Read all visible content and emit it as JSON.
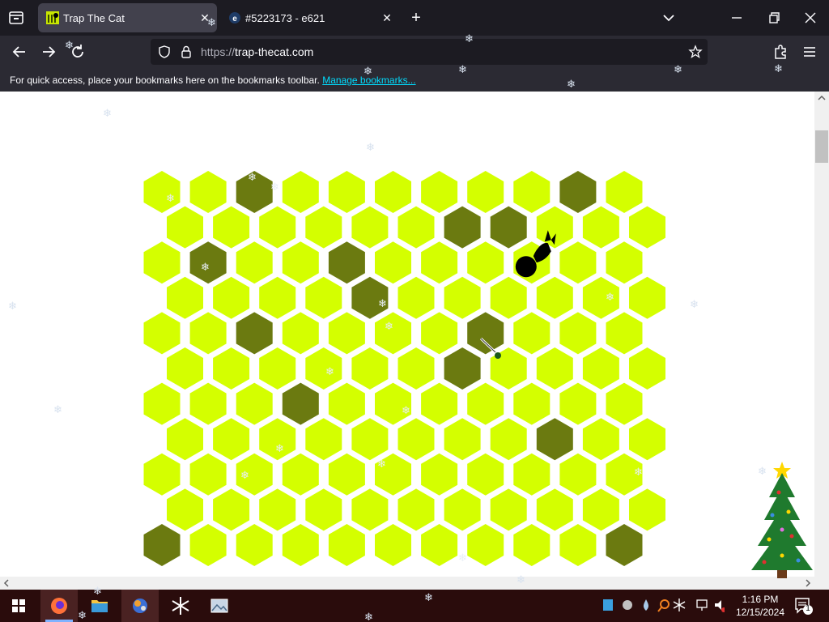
{
  "browser": {
    "tabs": [
      {
        "title": "Trap The Cat",
        "active": true,
        "favicon": "trap-cat-favicon"
      },
      {
        "title": "#5223173 - e621",
        "active": false,
        "favicon": "e621-favicon"
      }
    ],
    "new_tab_label": "+",
    "url": {
      "scheme": "https://",
      "host": "trap-thecat.com"
    },
    "bookmarks_message": "For quick access, place your bookmarks here on the bookmarks toolbar.",
    "bookmarks_link": "Manage bookmarks..."
  },
  "game": {
    "name": "Trap The Cat",
    "rows": 11,
    "cols": 11,
    "colors": {
      "open": "#d4ff00",
      "blocked": "#6b7a10",
      "cat": "#000000",
      "page_bg": "#ffffff"
    },
    "blocked_cells": [
      [
        0,
        2
      ],
      [
        0,
        9
      ],
      [
        1,
        6
      ],
      [
        1,
        7
      ],
      [
        2,
        1
      ],
      [
        2,
        4
      ],
      [
        3,
        4
      ],
      [
        4,
        2
      ],
      [
        4,
        7
      ],
      [
        5,
        6
      ],
      [
        6,
        3
      ],
      [
        7,
        8
      ],
      [
        10,
        0
      ],
      [
        10,
        10
      ]
    ],
    "cat_position": [
      2,
      8
    ]
  },
  "taskbar": {
    "apps": [
      "windows-start",
      "firefox",
      "file-explorer",
      "app-3",
      "app-4",
      "app-5"
    ],
    "time": "1:16 PM",
    "date": "12/15/2024",
    "notification_count": "1"
  }
}
